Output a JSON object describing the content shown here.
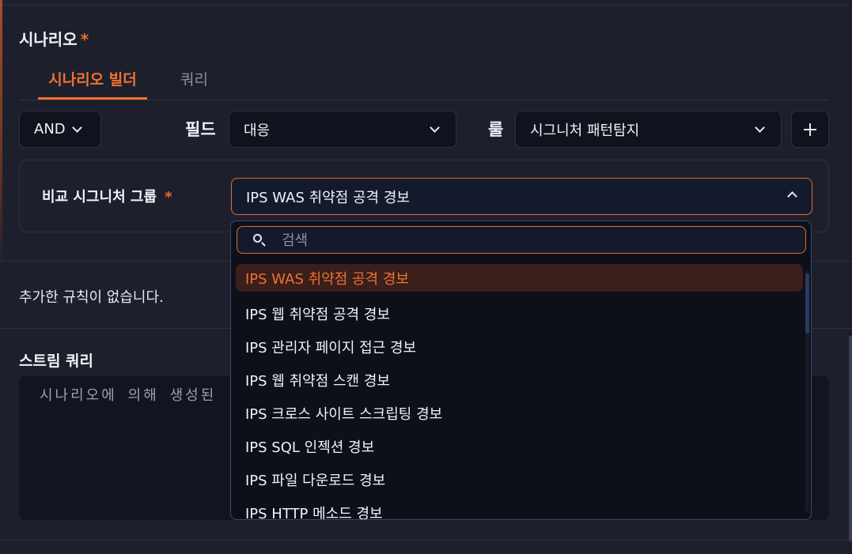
{
  "section": {
    "title": "시나리오",
    "required_mark": "*"
  },
  "tabs": [
    {
      "label": "시나리오 빌더",
      "active": true
    },
    {
      "label": "쿼리",
      "active": false
    }
  ],
  "builder": {
    "operator": "AND",
    "field_label": "필드",
    "field_value": "대응",
    "rule_label": "룰",
    "rule_value": "시그니처 패턴탐지"
  },
  "compare": {
    "label": "비교 시그니처 그룹",
    "required_mark": "*",
    "selected": "IPS WAS 취약점 공격 경보"
  },
  "dropdown": {
    "search_placeholder": "검색",
    "options": [
      "IPS WAS 취약점 공격 경보",
      "IPS 웹 취약점 공격 경보",
      "IPS 관리자 페이지 접근 경보",
      "IPS 웹 취약점 스캔 경보",
      "IPS 크로스 사이트 스크립팅 경보",
      "IPS SQL 인젝션 경보",
      "IPS 파일 다운로드 경보",
      "IPS HTTP 메소드 경보"
    ]
  },
  "rules": {
    "empty_text": "추가한 규칙이 없습니다."
  },
  "stream": {
    "title": "스트림 쿼리",
    "placeholder": "시나리오에 의해 생성된"
  },
  "colors": {
    "accent": "#f07232",
    "background": "#1d202c",
    "panel": "#10131d"
  }
}
